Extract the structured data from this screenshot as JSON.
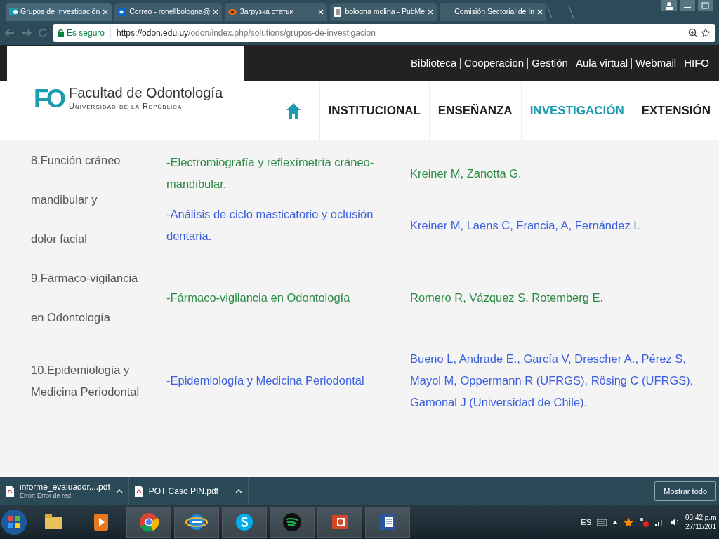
{
  "browser": {
    "tabs": [
      {
        "title": "Grupos de Investigación",
        "selected": true
      },
      {
        "title": "Correo - ronellbologna@",
        "selected": false
      },
      {
        "title": "Загрузка статьи",
        "selected": false
      },
      {
        "title": "bologna molina - PubMe",
        "selected": false
      },
      {
        "title": "Comisión Sectorial de In",
        "selected": false
      }
    ],
    "security": "Es seguro",
    "url_host": "https://odon.edu.uy",
    "url_path": "/odon/index.php/solutions/grupos-de-investigacion"
  },
  "site": {
    "top_links": [
      "Biblioteca",
      "Cooperacion",
      "Gestión",
      "Aula virtual",
      "Webmail",
      "HIFO"
    ],
    "logo": {
      "mark": "FO",
      "name": "Facultad de Odontología",
      "subtitle": "Universidad de la República"
    },
    "nav": [
      {
        "label": "INSTITUCIONAL",
        "selected": false
      },
      {
        "label": "ENSEÑANZA",
        "selected": false
      },
      {
        "label": "INVESTIGACIÓN",
        "selected": true
      },
      {
        "label": "EXTENSIÓN",
        "selected": false
      }
    ]
  },
  "groups": [
    {
      "kind": "spaced",
      "name_lines": [
        "8.Función cráneo",
        "mandibular y",
        "dolor facial"
      ],
      "lines": [
        {
          "topic": "-Electromiografía y reflexímetría cráneo-mandibular.",
          "authors": "Kreiner M, Zanotta G.",
          "color": "#2e8b47"
        },
        {
          "topic": "-Análisis de ciclo masticatorio y oclusión dentaria.",
          "authors": "Kreiner M, Laens C, Francia, A, Fernández I.",
          "color": "#3b5fe0"
        }
      ]
    },
    {
      "kind": "spaced",
      "name_lines": [
        "9.Fármaco-vigilancia",
        "en Odontología"
      ],
      "lines": [
        {
          "topic": "-Fármaco-vigilancia en Odontología",
          "authors": "Romero R, Vázquez S, Rotemberg E.",
          "color": "#2e8b47"
        }
      ]
    },
    {
      "kind": "wrapped",
      "name_lines": [
        "10.Epidemiología y Medicina Periodontal"
      ],
      "lines": [
        {
          "topic": "-Epidemiología y Medicina Periodontal",
          "authors": "Bueno L, Andrade E., García V, Drescher A., Pérez S, Mayol M, Oppermann R (UFRGS), Rösing C (UFRGS), Gamonal J (Universidad de Chile).",
          "color": "#3b5fe0"
        }
      ]
    }
  ],
  "downloads": {
    "items": [
      {
        "file": "informe_evaluador....pdf",
        "status": "Error: Error de red"
      },
      {
        "file": "POT Caso PIN.pdf"
      }
    ],
    "show_all": "Mostrar todo"
  },
  "taskbar": {
    "language": "ES",
    "time": "03:42 p.m",
    "date": "27/11/201"
  }
}
